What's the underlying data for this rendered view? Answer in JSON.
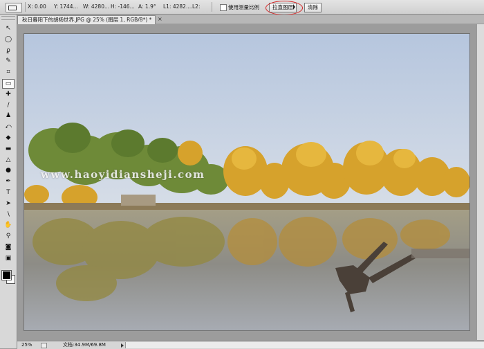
{
  "options_bar": {
    "x": "X: 0.00",
    "y": "Y: 1744...",
    "w": "W: 4280...",
    "h": "H: -146...",
    "angle": "A: 1.9°",
    "l1": "L1: 4282....",
    "l2": "L2:",
    "checkbox_label": "使用测量比例",
    "straighten_label": "拉直图层",
    "clear_label": "清除",
    "highlight_color": "#d62020"
  },
  "tab": {
    "title": "秋日暮阳下的胡杨世界.JPG @ 25% (图层 1, RGB/8*) *",
    "close": "×"
  },
  "toolbar": {
    "tools": [
      {
        "name": "move-tool-icon",
        "glyph": "↖"
      },
      {
        "name": "marquee-tool-icon",
        "glyph": "◯"
      },
      {
        "name": "lasso-tool-icon",
        "glyph": "ϼ"
      },
      {
        "name": "quick-select-tool-icon",
        "glyph": "✎"
      },
      {
        "name": "crop-tool-icon",
        "glyph": "⌗"
      },
      {
        "name": "ruler-tool-icon",
        "glyph": "▭"
      },
      {
        "name": "healing-tool-icon",
        "glyph": "✚"
      },
      {
        "name": "brush-tool-icon",
        "glyph": "∕"
      },
      {
        "name": "stamp-tool-icon",
        "glyph": "♟"
      },
      {
        "name": "history-brush-tool-icon",
        "glyph": "⤺"
      },
      {
        "name": "eraser-tool-icon",
        "glyph": "◆"
      },
      {
        "name": "gradient-tool-icon",
        "glyph": "▬"
      },
      {
        "name": "blur-tool-icon",
        "glyph": "△"
      },
      {
        "name": "dodge-tool-icon",
        "glyph": "●"
      },
      {
        "name": "pen-tool-icon",
        "glyph": "✒"
      },
      {
        "name": "type-tool-icon",
        "glyph": "T"
      },
      {
        "name": "path-select-tool-icon",
        "glyph": "➤"
      },
      {
        "name": "line-tool-icon",
        "glyph": "∖"
      },
      {
        "name": "hand-tool-icon",
        "glyph": "✋"
      },
      {
        "name": "zoom-tool-icon",
        "glyph": "⚲"
      },
      {
        "name": "quick-mask-icon",
        "glyph": "◙"
      },
      {
        "name": "screen-mode-icon",
        "glyph": "▣"
      }
    ],
    "active_index": 5,
    "foreground_color": "#000000",
    "background_color": "#ffffff"
  },
  "canvas": {
    "watermark": "www.haoyidiansheji.com"
  },
  "status": {
    "zoom": "25%",
    "doc": "文档:34.9M/69.8M"
  }
}
